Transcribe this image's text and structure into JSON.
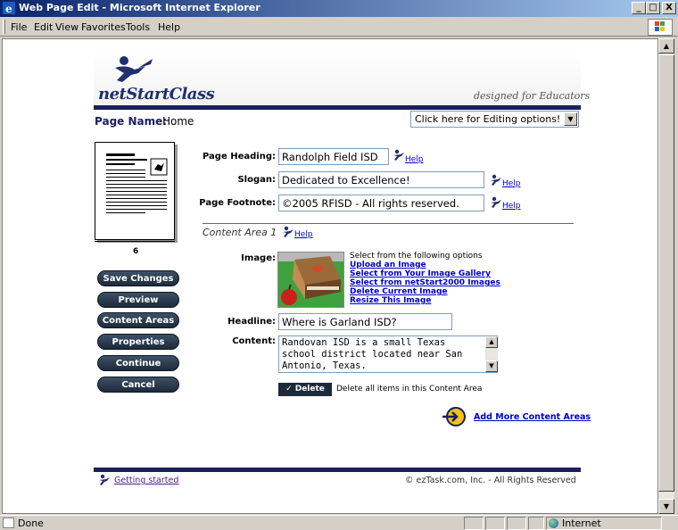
{
  "window": {
    "title": "Web Page Edit - Microsoft Internet Explorer",
    "buttons": [
      "_",
      "□",
      "X"
    ]
  },
  "menu": {
    "items": [
      {
        "label": "File"
      },
      {
        "label": "Edit"
      },
      {
        "label": "View"
      },
      {
        "label": "Favorites"
      },
      {
        "label": "Tools"
      },
      {
        "label": "Help"
      }
    ]
  },
  "header": {
    "brand": "netStartClass",
    "tagline": "designed for Educators"
  },
  "page": {
    "name_label": "Page Name:",
    "name_value": "Home",
    "edit_options": "Click here for Editing options!"
  },
  "sidebar": {
    "thumbnail_number": "6",
    "buttons": [
      {
        "label": "Save Changes"
      },
      {
        "label": "Preview"
      },
      {
        "label": "Content Areas"
      },
      {
        "label": "Properties"
      },
      {
        "label": "Continue"
      },
      {
        "label": "Cancel"
      }
    ]
  },
  "form": {
    "heading_label": "Page Heading:",
    "heading_value": "Randolph Field ISD",
    "slogan_label": "Slogan:",
    "slogan_value": "Dedicated to Excellence!",
    "footnote_label": "Page Footnote:",
    "footnote_value": "©2005 RFISD - All rights reserved.",
    "help_label": "Help"
  },
  "content_area": {
    "title": "Content Area 1",
    "image_label": "Image:",
    "image_prompt": "Select from the following options",
    "image_options": [
      "Upload an Image",
      "Select from Your Image Gallery",
      "Select from netStart2000 Images",
      "Delete Current Image",
      "Resize This Image"
    ],
    "headline_label": "Headline:",
    "headline_value": "Where is Garland ISD?",
    "content_label": "Content:",
    "content_lines": [
      "Randovan ISD is a small Texas",
      "school district located near San",
      "Antonio, Texas."
    ],
    "delete_button": "✓ Delete",
    "delete_text": "Delete all items in this Content Area",
    "add_more": "Add More Content Areas"
  },
  "footer": {
    "getting_started": "Getting started",
    "copyright": "© ezTask.com, Inc. - All Rights Reserved"
  },
  "status": {
    "text": "Done",
    "zone": "Internet"
  }
}
